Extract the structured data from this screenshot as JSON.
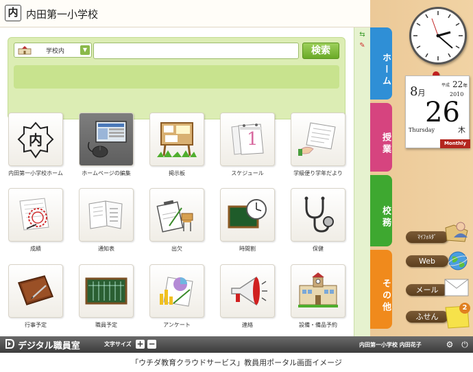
{
  "header": {
    "logo_char": "内",
    "school_name": "内田第一小学校"
  },
  "search": {
    "scope_label": "学校内",
    "input_value": "",
    "button_label": "検索"
  },
  "tiles": [
    {
      "label": "内田第一小学校ホーム",
      "icon": "school-crest-icon"
    },
    {
      "label": "ホームページの編集",
      "icon": "monitor-mouse-icon"
    },
    {
      "label": "掲示板",
      "icon": "bulletin-board-icon"
    },
    {
      "label": "スケジュール",
      "icon": "calendar-icon"
    },
    {
      "label": "学級便り学年だより",
      "icon": "letter-handout-icon"
    },
    {
      "label": "成績",
      "icon": "grades-stamp-icon"
    },
    {
      "label": "通知表",
      "icon": "report-card-icon"
    },
    {
      "label": "出欠",
      "icon": "attendance-clipboard-icon"
    },
    {
      "label": "時間割",
      "icon": "blackboard-clock-icon"
    },
    {
      "label": "保健",
      "icon": "stethoscope-icon"
    },
    {
      "label": "行事予定",
      "icon": "planner-book-icon"
    },
    {
      "label": "職員予定",
      "icon": "chalkboard-schedule-icon"
    },
    {
      "label": "アンケート",
      "icon": "survey-chart-icon"
    },
    {
      "label": "連絡",
      "icon": "megaphone-icon"
    },
    {
      "label": "設備・備品予約",
      "icon": "school-building-icon"
    }
  ],
  "tabs": [
    {
      "label": "ホーム",
      "color": "#2f8fd6"
    },
    {
      "label": "授業",
      "color": "#d6447f"
    },
    {
      "label": "校務",
      "color": "#3ea830"
    },
    {
      "label": "その他",
      "color": "#f08a1c"
    }
  ],
  "calendar": {
    "month": "8",
    "month_suffix": "月",
    "era": "平成",
    "era_year": "22",
    "era_suffix": "年",
    "year": "2010",
    "day": "26",
    "weekday_en": "Thursday",
    "weekday_jp": "木",
    "monthly_label": "Monthly"
  },
  "side_buttons": {
    "my_folder": "ﾏｲﾌｫﾙﾀﾞ",
    "web": "Web",
    "mail": "メール",
    "sticky": "ふせん",
    "sticky_count": "2"
  },
  "footer": {
    "title": "デジタル職員室",
    "font_size_label": "文字サイズ",
    "plus": "+",
    "minus": "−",
    "user": "内田第一小学校 内田花子"
  },
  "caption": "「ウチダ教育クラウドサービス」教員用ポータル画面イメージ"
}
